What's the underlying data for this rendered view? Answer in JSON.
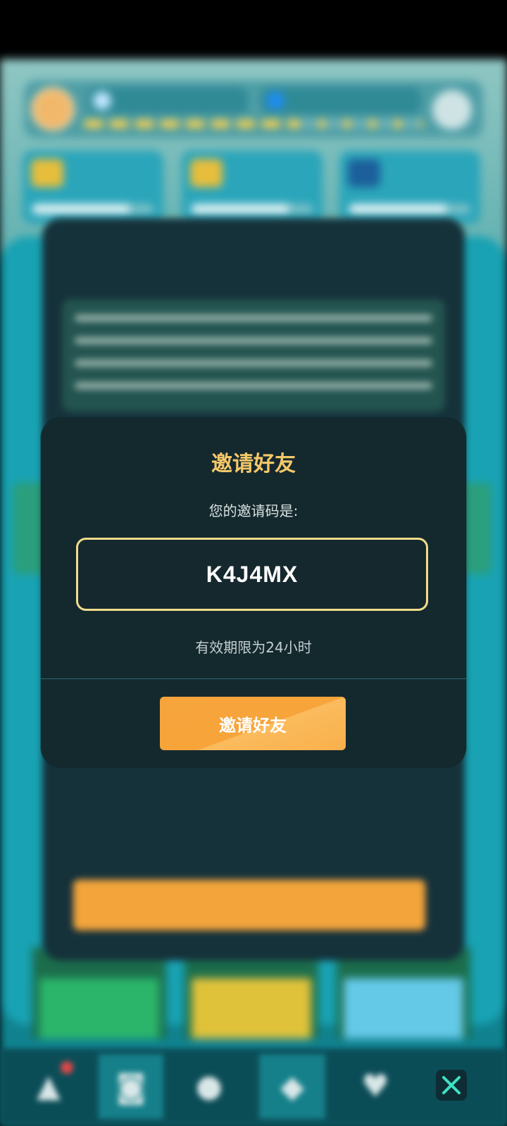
{
  "modal": {
    "title": "邀请好友",
    "subtitle": "您的邀请码是:",
    "invite_code": "K4J4MX",
    "validity_note": "有效期限为24小时",
    "invite_button_label": "邀请好友"
  },
  "colors": {
    "modal_background": "#14292e",
    "title": "#f6c86a",
    "code_border": "#f2dc8c",
    "button": "#f6a43c"
  },
  "background": {
    "blurred": true,
    "bottom_nav": {
      "icons": [
        "triangle-icon",
        "cup-icon",
        "circle-icon",
        "diamond-icon",
        "heart-icon",
        "close-icon"
      ],
      "active_index": 1,
      "notification_dot_on": "triangle-icon"
    }
  }
}
